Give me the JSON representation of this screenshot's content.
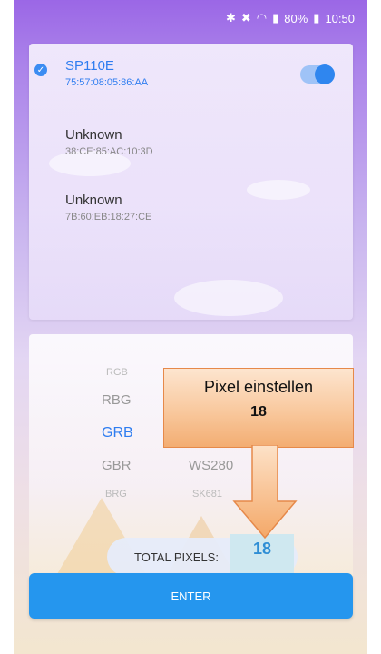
{
  "status_bar": {
    "icons": [
      "bluetooth-icon",
      "mute-icon",
      "wifi-icon",
      "signal-icon",
      "battery-icon"
    ],
    "battery": "80%",
    "time": "10:50"
  },
  "devices": [
    {
      "name": "SP110E",
      "mac": "75:57:08:05:86:AA",
      "selected": true
    },
    {
      "name": "Unknown",
      "mac": "38:CE:85:AC:10:3D",
      "selected": false
    },
    {
      "name": "Unknown",
      "mac": "7B:60:EB:18:27:CE",
      "selected": false
    }
  ],
  "toggle": {
    "on": true
  },
  "picker": {
    "color_order": [
      "RGB",
      "RBG",
      "GRB",
      "GBR",
      "BRG"
    ],
    "selected_color_order": "GRB",
    "chip_types": [
      "WS280",
      "SK681"
    ]
  },
  "total": {
    "label": "TOTAL PIXELS:",
    "value": "18"
  },
  "enter_label": "ENTER",
  "annotation": {
    "title": "Pixel einstellen",
    "value": "18"
  },
  "colors": {
    "accent": "#2596ee",
    "selected_text": "#2f7df0"
  }
}
